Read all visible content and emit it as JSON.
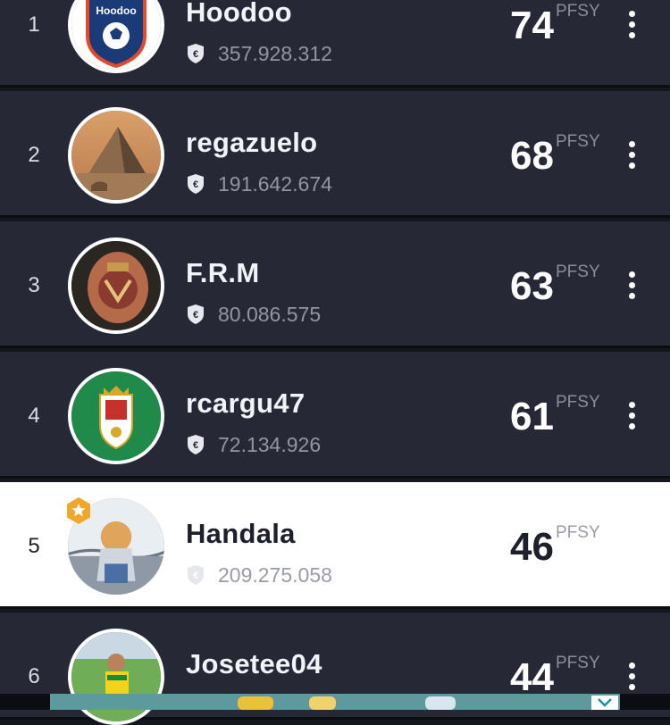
{
  "currency_icon": "euro-shield-icon",
  "score_unit": "PFSY",
  "colors": {
    "row_bg": "#262836",
    "current_user_bg": "#ffffff",
    "badge": "#f0a72c",
    "separator": "#0c0d12"
  },
  "leaderboard": [
    {
      "rank": "1",
      "name": "Hoodoo",
      "money": "357.928.312",
      "score": "74"
    },
    {
      "rank": "2",
      "name": "regazuelo",
      "money": "191.642.674",
      "score": "68"
    },
    {
      "rank": "3",
      "name": "F.R.M",
      "money": "80.086.575",
      "score": "63"
    },
    {
      "rank": "4",
      "name": "rcargu47",
      "money": "72.134.926",
      "score": "61"
    },
    {
      "rank": "5",
      "name": "Handala",
      "money": "209.275.058",
      "score": "46",
      "current_user": true
    },
    {
      "rank": "6",
      "name": "Josetee04",
      "money": "",
      "score": "44"
    }
  ],
  "avatar_logo_text": "Hoodoo"
}
